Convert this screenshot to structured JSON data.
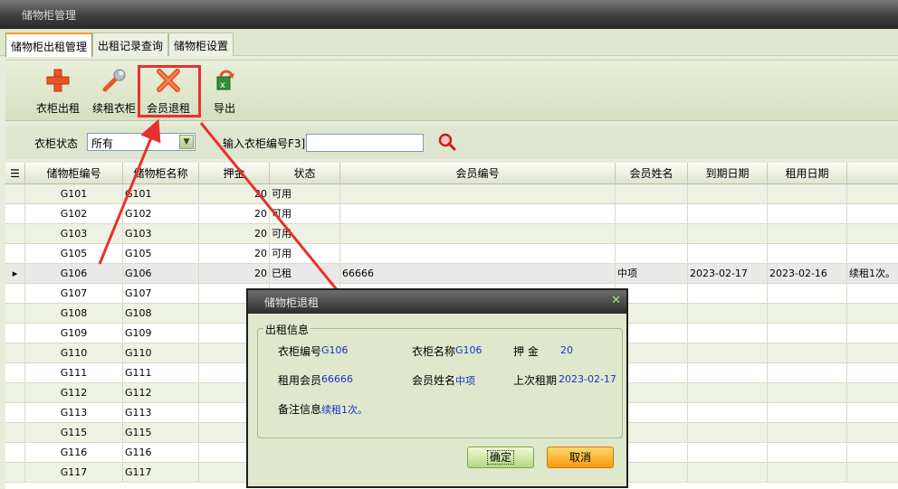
{
  "window": {
    "title": "储物柜管理"
  },
  "tabs": [
    "储物柜出租管理",
    "出租记录查询",
    "储物柜设置"
  ],
  "toolbar": {
    "rent": "衣柜出租",
    "renew": "续租衣柜",
    "return": "会员退租",
    "export": "导出"
  },
  "filter": {
    "status_label": "衣柜状态",
    "status_value": "所有",
    "number_label": "输入衣柜编号F3]"
  },
  "grid": {
    "headers": [
      "储物柜编号",
      "储物柜名称",
      "押金",
      "状态",
      "会员编号",
      "会员姓名",
      "到期日期",
      "租用日期"
    ],
    "rows": [
      {
        "no": "G101",
        "name": "G101",
        "deposit": "20",
        "status": "可用",
        "member": "",
        "mname": "",
        "due": "",
        "rent": "",
        "note": ""
      },
      {
        "no": "G102",
        "name": "G102",
        "deposit": "20",
        "status": "可用",
        "member": "",
        "mname": "",
        "due": "",
        "rent": "",
        "note": ""
      },
      {
        "no": "G103",
        "name": "G103",
        "deposit": "20",
        "status": "可用",
        "member": "",
        "mname": "",
        "due": "",
        "rent": "",
        "note": ""
      },
      {
        "no": "G105",
        "name": "G105",
        "deposit": "20",
        "status": "可用",
        "member": "",
        "mname": "",
        "due": "",
        "rent": "",
        "note": ""
      },
      {
        "no": "G106",
        "name": "G106",
        "deposit": "20",
        "status": "已租",
        "member": "66666",
        "mname": "中项",
        "due": "2023-02-17",
        "rent": "2023-02-16",
        "note": "续租1次。"
      },
      {
        "no": "G107",
        "name": "G107",
        "deposit": "",
        "status": "",
        "member": "",
        "mname": "",
        "due": "",
        "rent": "",
        "note": ""
      },
      {
        "no": "G108",
        "name": "G108",
        "deposit": "",
        "status": "",
        "member": "",
        "mname": "",
        "due": "",
        "rent": "",
        "note": ""
      },
      {
        "no": "G109",
        "name": "G109",
        "deposit": "",
        "status": "",
        "member": "",
        "mname": "",
        "due": "",
        "rent": "",
        "note": ""
      },
      {
        "no": "G110",
        "name": "G110",
        "deposit": "",
        "status": "",
        "member": "",
        "mname": "",
        "due": "",
        "rent": "",
        "note": ""
      },
      {
        "no": "G111",
        "name": "G111",
        "deposit": "",
        "status": "",
        "member": "",
        "mname": "",
        "due": "",
        "rent": "",
        "note": ""
      },
      {
        "no": "G112",
        "name": "G112",
        "deposit": "",
        "status": "",
        "member": "",
        "mname": "",
        "due": "",
        "rent": "",
        "note": ""
      },
      {
        "no": "G113",
        "name": "G113",
        "deposit": "",
        "status": "",
        "member": "",
        "mname": "",
        "due": "",
        "rent": "",
        "note": ""
      },
      {
        "no": "G115",
        "name": "G115",
        "deposit": "",
        "status": "",
        "member": "",
        "mname": "",
        "due": "",
        "rent": "",
        "note": ""
      },
      {
        "no": "G116",
        "name": "G116",
        "deposit": "",
        "status": "",
        "member": "",
        "mname": "",
        "due": "",
        "rent": "",
        "note": ""
      },
      {
        "no": "G117",
        "name": "G117",
        "deposit": "",
        "status": "",
        "member": "",
        "mname": "",
        "due": "",
        "rent": "",
        "note": ""
      }
    ]
  },
  "dialog": {
    "title": "储物柜退租",
    "group_title": "出租信息",
    "labels": {
      "locker_no": "衣柜编号",
      "locker_name": "衣柜名称",
      "deposit": "押  金",
      "member_no": "租用会员",
      "member_name": "会员姓名",
      "last_rent": "上次租期",
      "note": "备注信息"
    },
    "values": {
      "locker_no": "G106",
      "locker_name": "G106",
      "deposit": "20",
      "member_no": "66666",
      "member_name": "中项",
      "last_rent": "2023-02-17",
      "note": "续租1次。"
    },
    "ok": "确定",
    "cancel": "取消"
  },
  "colors": {
    "annotation": "#e8312d",
    "ok": "#b4d880",
    "cancel": "#f59a10"
  }
}
